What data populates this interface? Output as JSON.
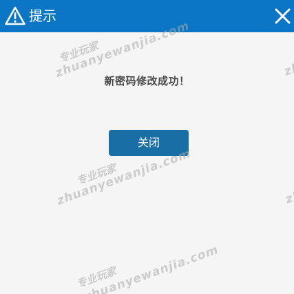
{
  "dialog": {
    "title": "提示",
    "message": "新密码修改成功！",
    "close_button_label": "关闭",
    "title_icon": "warning-icon",
    "close_icon": "close-icon"
  },
  "watermarks": {
    "text_cn": "专业玩家",
    "text_en": "zhuanyewanjia.com"
  },
  "colors": {
    "titlebar": "#0b76c5",
    "button": "#1a6ea6",
    "background": "#f5f5f5"
  }
}
